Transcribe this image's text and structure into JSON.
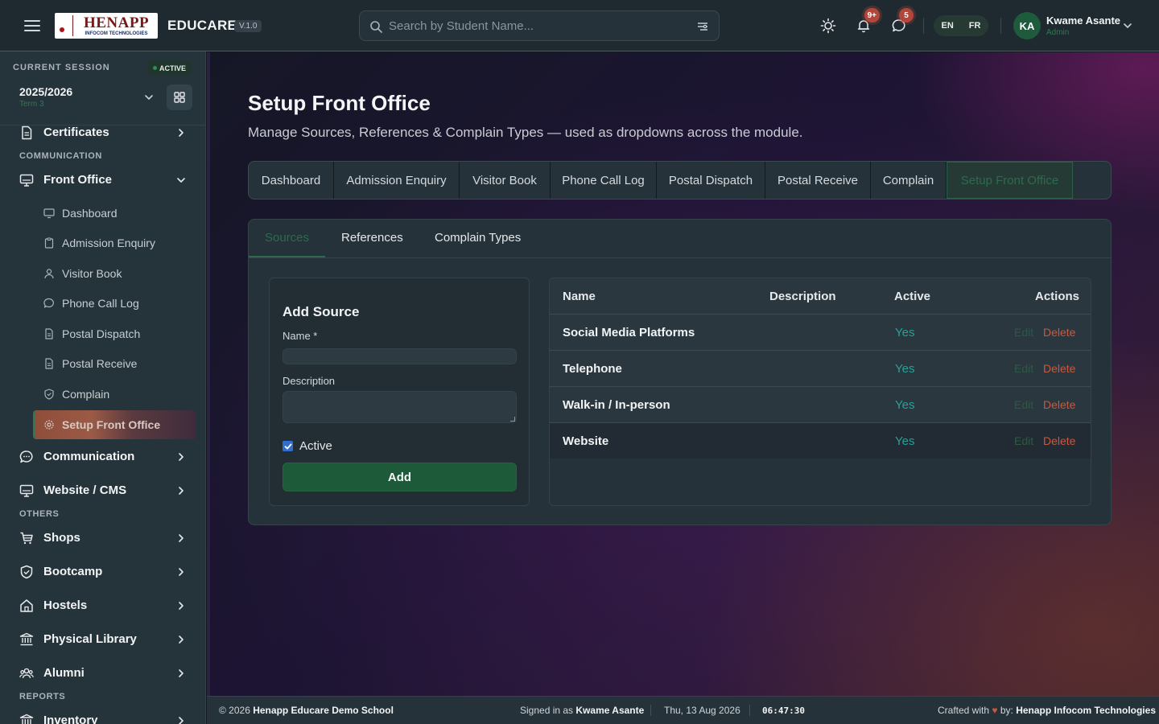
{
  "header": {
    "logo_big": "HENAPP",
    "logo_small": "INFOCOM TECHNOLOGIES",
    "app_name": "EDUCARE",
    "version": "V.1.0",
    "search_placeholder": "Search by Student Name...",
    "notifications_badge": "9+",
    "messages_badge": "5",
    "lang_en": "EN",
    "lang_fr": "FR",
    "user_initials": "KA",
    "user_name": "Kwame Asante",
    "user_role": "Admin"
  },
  "sidebar": {
    "session_label": "CURRENT SESSION",
    "session_status": "ACTIVE",
    "session_year": "2025/2026",
    "session_term": "Term 3",
    "items": {
      "certificates": "Certificates",
      "section_communication": "COMMUNICATION",
      "front_office": "Front Office",
      "communication": "Communication",
      "website_cms": "Website / CMS",
      "section_others": "OTHERS",
      "shops": "Shops",
      "bootcamp": "Bootcamp",
      "hostels": "Hostels",
      "physical_library": "Physical Library",
      "alumni": "Alumni",
      "section_reports": "REPORTS",
      "inventory": "Inventory"
    },
    "front_office_sub": [
      "Dashboard",
      "Admission Enquiry",
      "Visitor Book",
      "Phone Call Log",
      "Postal Dispatch",
      "Postal Receive",
      "Complain",
      "Setup Front Office"
    ]
  },
  "page": {
    "title": "Setup Front Office",
    "subtitle": "Manage Sources, References & Complain Types — used as dropdowns across the module.",
    "tabs": [
      "Dashboard",
      "Admission Enquiry",
      "Visitor Book",
      "Phone Call Log",
      "Postal Dispatch",
      "Postal Receive",
      "Complain",
      "Setup Front Office"
    ],
    "subtabs": [
      "Sources",
      "References",
      "Complain Types"
    ]
  },
  "form": {
    "heading": "Add Source",
    "name_label": "Name *",
    "description_label": "Description",
    "active_label": "Active",
    "submit_label": "Add"
  },
  "table": {
    "headers": [
      "Name",
      "Description",
      "Active",
      "Actions"
    ],
    "rows": [
      {
        "name": "Social Media Platforms",
        "description": "",
        "active": "Yes",
        "edit": "Edit",
        "delete": "Delete"
      },
      {
        "name": "Telephone",
        "description": "",
        "active": "Yes",
        "edit": "Edit",
        "delete": "Delete"
      },
      {
        "name": "Walk-in / In-person",
        "description": "",
        "active": "Yes",
        "edit": "Edit",
        "delete": "Delete"
      },
      {
        "name": "Website",
        "description": "",
        "active": "Yes",
        "edit": "Edit",
        "delete": "Delete"
      }
    ]
  },
  "footer": {
    "copyright_prefix": "© 2026",
    "school": "Henapp Educare Demo School",
    "signed_in_prefix": "Signed in as",
    "signed_in_user": "Kwame Asante",
    "date": "Thu, 13 Aug 2026",
    "time": "06:47:30",
    "crafted_prefix": "Crafted with",
    "crafted_by": "by:",
    "company": "Henapp Infocom Technologies"
  },
  "colors": {
    "accent_green": "#2e6b4c",
    "yes_teal": "#2aa095",
    "delete_red": "#c9583f",
    "badge_red": "#b2463b"
  }
}
